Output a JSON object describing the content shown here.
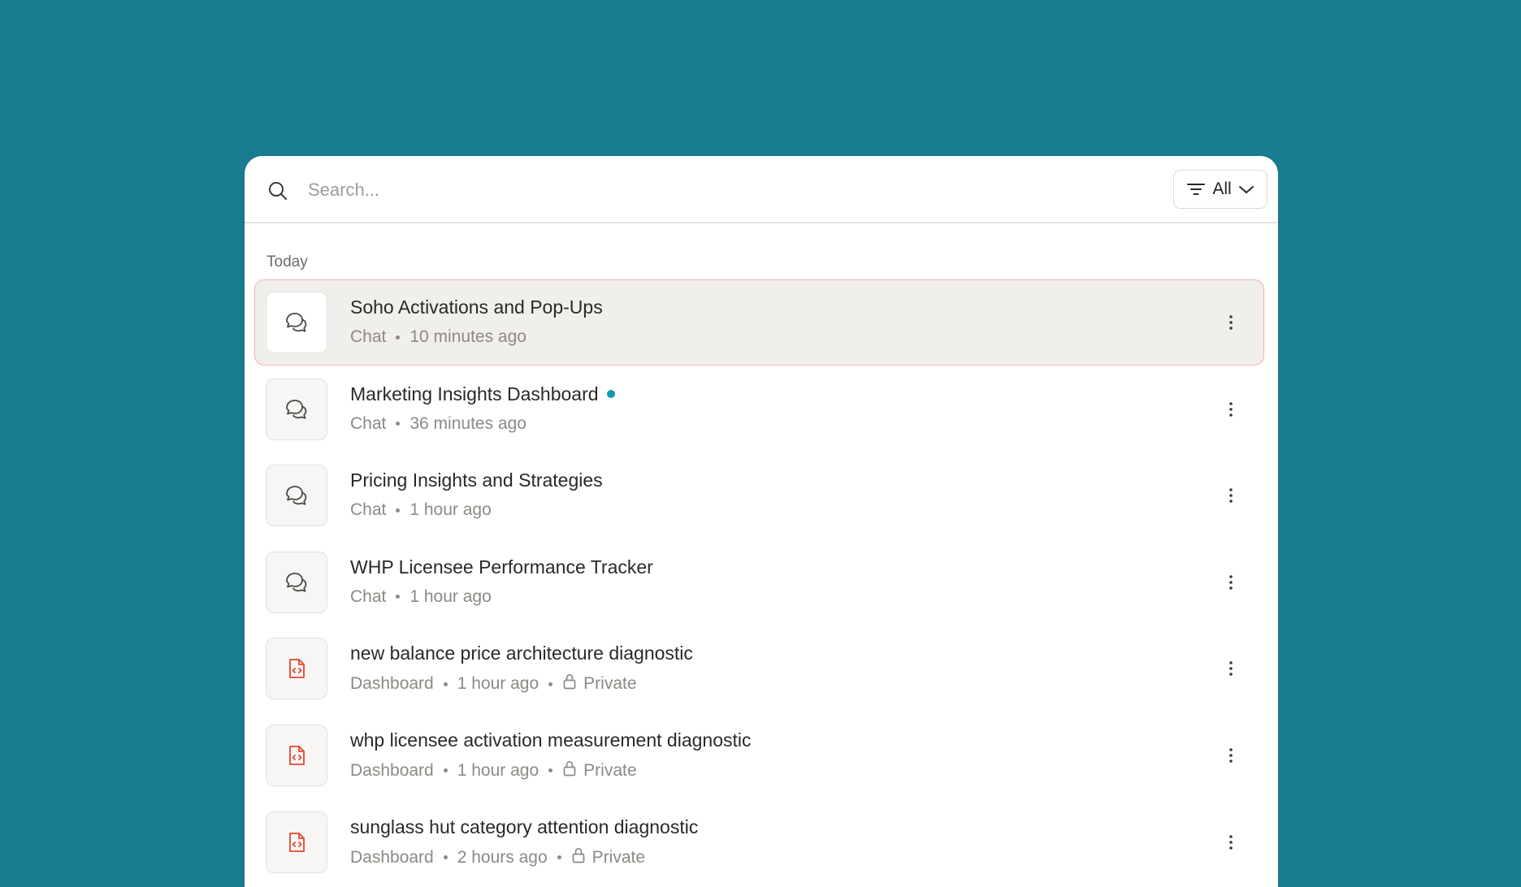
{
  "colors": {
    "background": "#187b8f",
    "selected_row_bg": "#f1efec",
    "selected_row_border": "#f0b5ad",
    "dashboard_icon": "#e4472e",
    "unread_dot": "#1396b5"
  },
  "search": {
    "placeholder": "Search...",
    "value": "",
    "icon": "search-icon"
  },
  "filter": {
    "label": "All",
    "icon": "filter-lines-icon",
    "chevron": "chevron-down-icon"
  },
  "section": {
    "label": "Today"
  },
  "items": [
    {
      "title": "Soho Activations and Pop-Ups",
      "type": "Chat",
      "time": "10 minutes ago",
      "private": false,
      "unread": false,
      "selected": true,
      "icon": "chat-bubbles-icon"
    },
    {
      "title": "Marketing Insights Dashboard",
      "type": "Chat",
      "time": "36 minutes ago",
      "private": false,
      "unread": true,
      "selected": false,
      "icon": "chat-bubbles-icon"
    },
    {
      "title": "Pricing Insights and Strategies",
      "type": "Chat",
      "time": "1 hour ago",
      "private": false,
      "unread": false,
      "selected": false,
      "icon": "chat-bubbles-icon"
    },
    {
      "title": "WHP Licensee Performance Tracker",
      "type": "Chat",
      "time": "1 hour ago",
      "private": false,
      "unread": false,
      "selected": false,
      "icon": "chat-bubbles-icon"
    },
    {
      "title": "new balance price architecture diagnostic",
      "type": "Dashboard",
      "time": "1 hour ago",
      "private": true,
      "privacy_label": "Private",
      "unread": false,
      "selected": false,
      "icon": "code-file-icon"
    },
    {
      "title": "whp licensee activation measurement diagnostic",
      "type": "Dashboard",
      "time": "1 hour ago",
      "private": true,
      "privacy_label": "Private",
      "unread": false,
      "selected": false,
      "icon": "code-file-icon"
    },
    {
      "title": "sunglass hut category attention diagnostic",
      "type": "Dashboard",
      "time": "2 hours ago",
      "private": true,
      "privacy_label": "Private",
      "unread": false,
      "selected": false,
      "icon": "code-file-icon"
    }
  ]
}
